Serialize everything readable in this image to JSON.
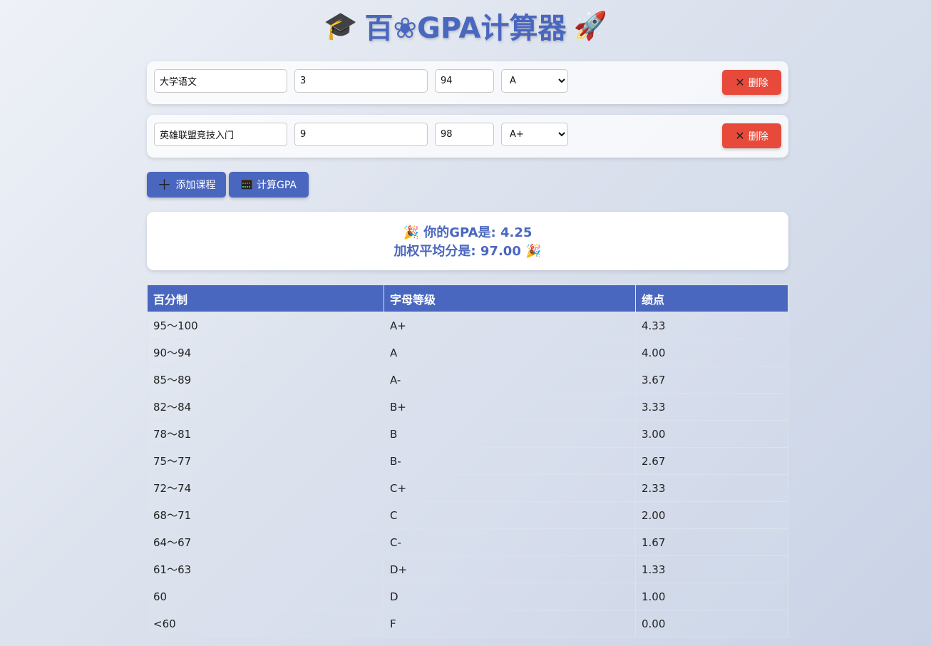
{
  "header": {
    "left_emoji": "🎓",
    "title": "百❀GPA计算器",
    "right_emoji": "🚀"
  },
  "courses": [
    {
      "name": "大学语文",
      "credit": "3",
      "score": "94",
      "grade": "A",
      "delete_label": "删除"
    },
    {
      "name": "英雄联盟竞技入门",
      "credit": "9",
      "score": "98",
      "grade": "A+",
      "delete_label": "删除"
    }
  ],
  "grade_options": [
    "A+",
    "A",
    "A-",
    "B+",
    "B",
    "B-",
    "C+",
    "C",
    "C-",
    "D+",
    "D",
    "F"
  ],
  "actions": {
    "add_label": "添加课程",
    "calc_label": "计算GPA"
  },
  "result": {
    "emoji": "🎉",
    "gpa_line": "你的GPA是: 4.25",
    "avg_line": "加权平均分是: 97.00"
  },
  "table": {
    "headers": [
      "百分制",
      "字母等级",
      "绩点"
    ],
    "rows": [
      [
        "95～100",
        "A+",
        "4.33"
      ],
      [
        "90～94",
        "A",
        "4.00"
      ],
      [
        "85～89",
        "A-",
        "3.67"
      ],
      [
        "82～84",
        "B+",
        "3.33"
      ],
      [
        "78～81",
        "B",
        "3.00"
      ],
      [
        "75～77",
        "B-",
        "2.67"
      ],
      [
        "72～74",
        "C+",
        "2.33"
      ],
      [
        "68～71",
        "C",
        "2.00"
      ],
      [
        "64～67",
        "C-",
        "1.67"
      ],
      [
        "61～63",
        "D+",
        "1.33"
      ],
      [
        "60",
        "D",
        "1.00"
      ],
      [
        "<60",
        "F",
        "0.00"
      ]
    ]
  },
  "colors": {
    "primary": "#4a67bf",
    "danger": "#e74a3b"
  }
}
